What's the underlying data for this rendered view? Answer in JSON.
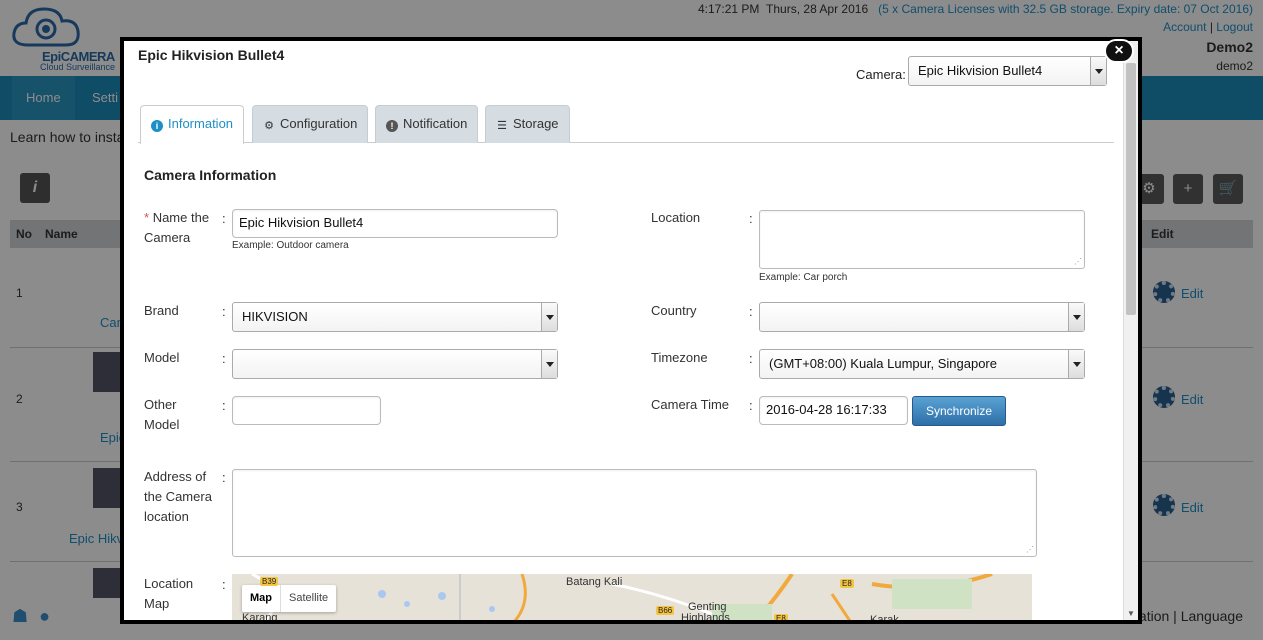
{
  "header": {
    "logo_text": "EpiCAMERA",
    "logo_sub": "Cloud Surveillance",
    "time": "4:17:21 PM",
    "date": "Thurs, 28 Apr 2016",
    "license": "(5 x Camera Licenses with 32.5 GB storage. Expiry date: 07 Oct 2016)",
    "account_link": "Account",
    "separator": "|",
    "logout_link": "Logout",
    "user_name": "Demo2",
    "user_id": "demo2"
  },
  "nav": {
    "home": "Home",
    "settings": "Setti"
  },
  "page": {
    "learn": "Learn how to insta",
    "table_headers": {
      "no": "No",
      "name": "Name",
      "edit": "Edit"
    },
    "rows": [
      {
        "no": "1",
        "name": "Cam",
        "edit": "Edit"
      },
      {
        "no": "2",
        "name": "Epic",
        "edit": "Edit"
      },
      {
        "no": "3",
        "name": "Epic Hikv",
        "edit": "Edit"
      }
    ],
    "footer_links": "cation | Language"
  },
  "modal": {
    "title": "Epic Hikvision Bullet4",
    "camera_label": "Camera:",
    "camera_selected": "Epic Hikvision Bullet4",
    "tabs": [
      {
        "label": "Information",
        "icon": "info-icon"
      },
      {
        "label": "Configuration",
        "icon": "gear-icon"
      },
      {
        "label": "Notification",
        "icon": "alert-icon"
      },
      {
        "label": "Storage",
        "icon": "storage-icon"
      }
    ],
    "section_title": "Camera Information",
    "fields": {
      "required_mark": "*",
      "name_label": "Name the Camera",
      "name_value": "Epic Hikvision Bullet4",
      "name_hint": "Example: Outdoor camera",
      "location_label": "Location",
      "location_hint": "Example: Car porch",
      "brand_label": "Brand",
      "brand_value": "HIKVISION",
      "country_label": "Country",
      "country_value": "",
      "model_label": "Model",
      "model_value": "",
      "timezone_label": "Timezone",
      "timezone_value": "(GMT+08:00) Kuala Lumpur, Singapore",
      "other_model_label": "Other Model",
      "other_model_value": "",
      "camera_time_label": "Camera Time",
      "camera_time_value": "2016-04-28 16:17:33",
      "sync_button": "Synchronize",
      "address_label": "Address of the Camera location",
      "location_map_label": "Location Map",
      "colon": ":"
    },
    "map": {
      "map_button": "Map",
      "satellite_button": "Satellite",
      "labels": [
        "Batang Kali",
        "Genting",
        "Highlands",
        "Karang",
        "Karak"
      ],
      "shields": [
        "B39",
        "B66",
        "E8",
        "E8"
      ]
    }
  }
}
